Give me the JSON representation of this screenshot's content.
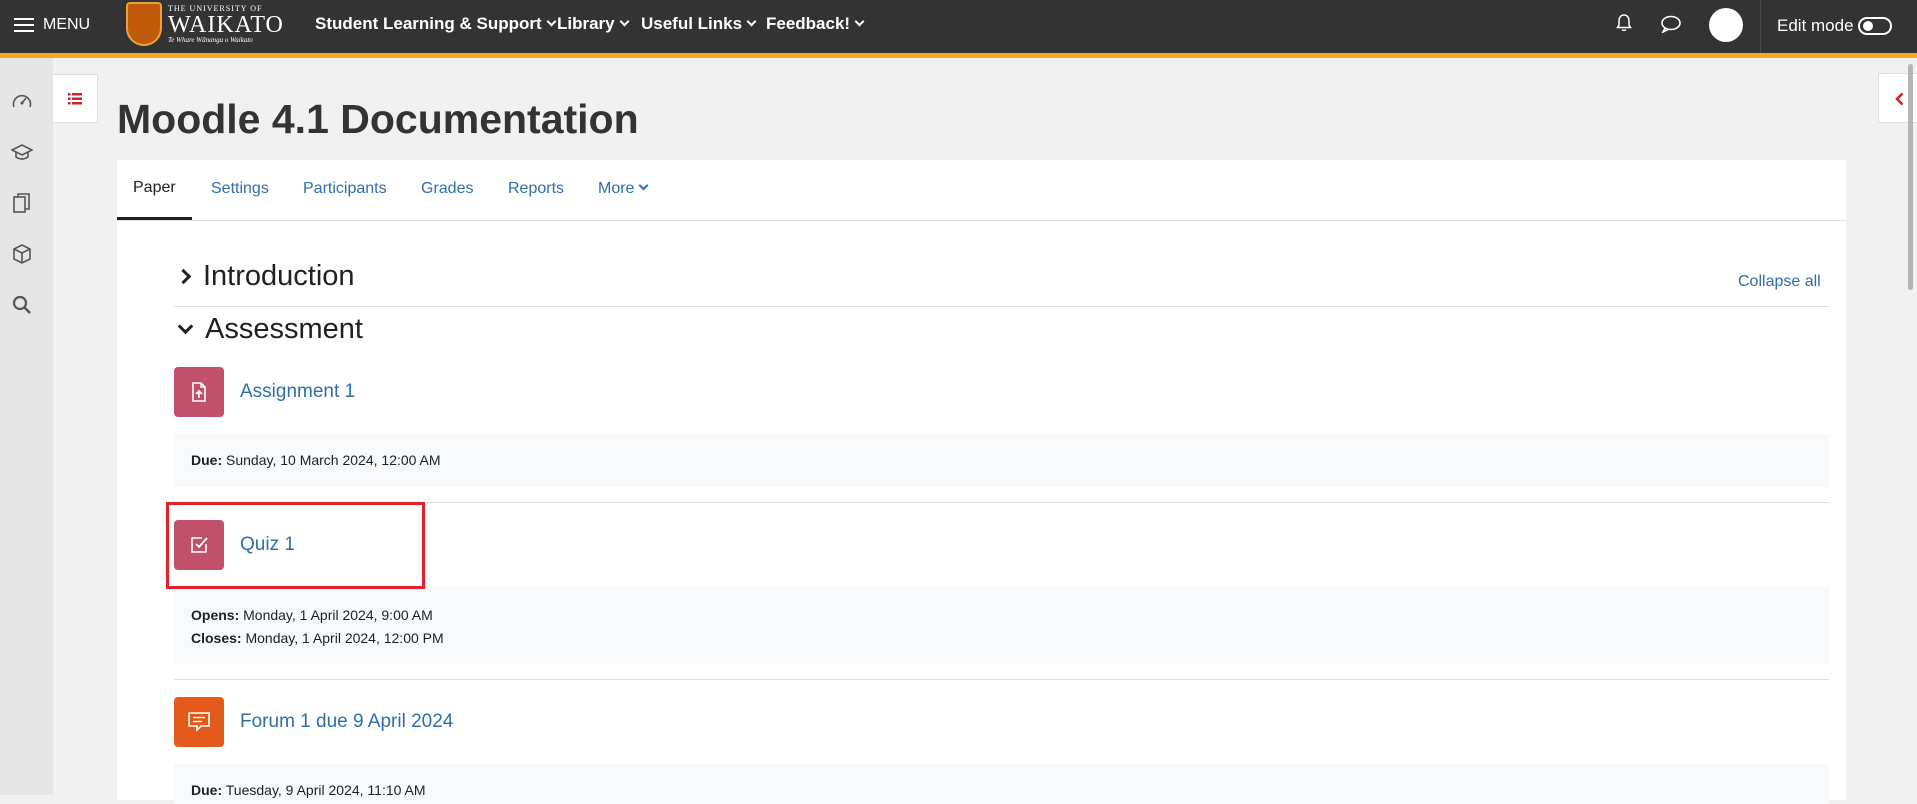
{
  "navbar": {
    "menu_label": "MENU",
    "logo_line1": "THE UNIVERSITY OF",
    "logo_line2": "WAIKATO",
    "logo_line3": "Te Whare Wānanga o Waikato",
    "menus": [
      "Student Learning & Support",
      "Library",
      "Useful Links",
      "Feedback!"
    ],
    "edit_mode_label": "Edit mode"
  },
  "page": {
    "title": "Moodle 4.1 Documentation"
  },
  "tabs": [
    "Paper",
    "Settings",
    "Participants",
    "Grades",
    "Reports",
    "More"
  ],
  "sections": {
    "collapse_all": "Collapse all",
    "introduction": "Introduction",
    "assessment": "Assessment"
  },
  "activities": [
    {
      "name": "Assignment 1",
      "icon": "assignment-icon",
      "color": "#c1506b",
      "dates": [
        {
          "label": "Due:",
          "value": "Sunday, 10 March 2024, 12:00 AM"
        }
      ]
    },
    {
      "name": "Quiz 1",
      "icon": "quiz-icon",
      "color": "#c1506b",
      "dates": [
        {
          "label": "Opens:",
          "value": "Monday, 1 April 2024, 9:00 AM"
        },
        {
          "label": "Closes:",
          "value": "Monday, 1 April 2024, 12:00 PM"
        }
      ]
    },
    {
      "name": "Forum 1 due 9 April 2024",
      "icon": "forum-icon",
      "color": "#e35a1b",
      "dates": [
        {
          "label": "Due:",
          "value": "Tuesday, 9 April 2024, 11:10 AM"
        }
      ]
    }
  ],
  "colors": {
    "navbar": "#333333",
    "accent": "#f5a623",
    "link": "#2f6ea8",
    "highlight": "#e3212b"
  }
}
